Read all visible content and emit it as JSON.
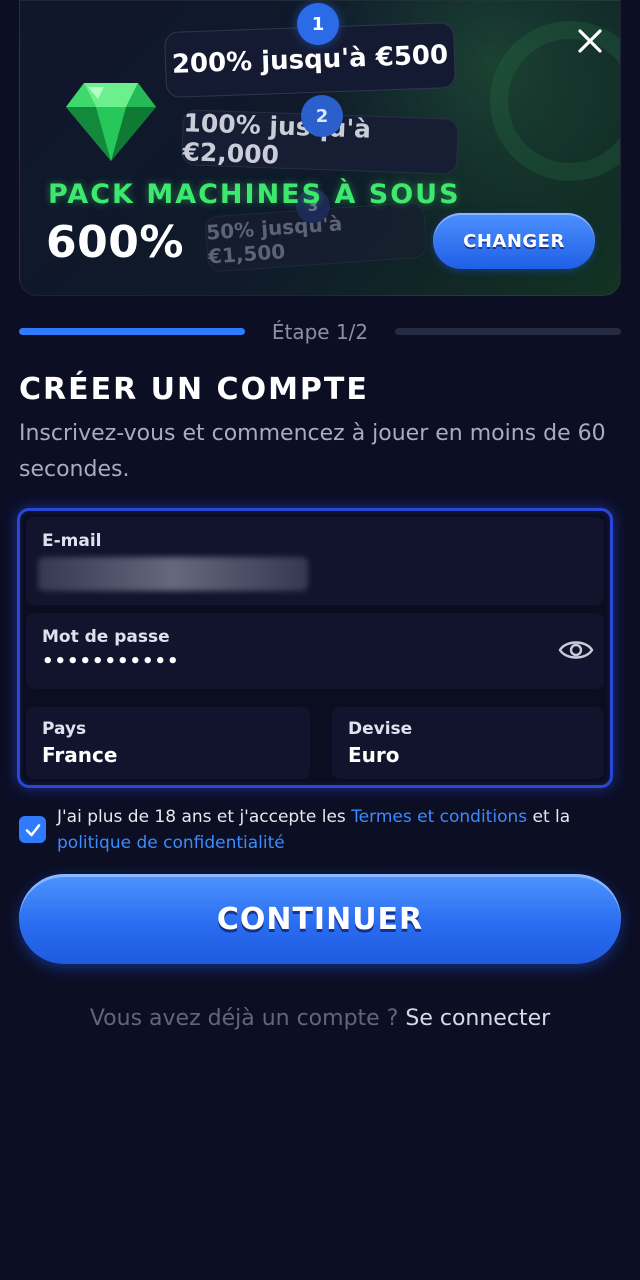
{
  "promo": {
    "tiers": [
      {
        "number": "1",
        "text": "200% jusqu'à €500"
      },
      {
        "number": "2",
        "text": "100% jusqu'à €2,000"
      },
      {
        "number": "3",
        "text": "50% jusqu'à €1,500"
      }
    ],
    "pack_title": "PACK MACHINES À SOUS",
    "pack_value": "600%",
    "change_label": "CHANGER",
    "accent_green": "#3ee86f"
  },
  "progress": {
    "step_label": "Étape 1/2",
    "active_color": "#2f7bff"
  },
  "heading": {
    "title": "CRÉER UN COMPTE",
    "subtitle": "Inscrivez-vous et commencez à jouer en moins de 60 secondes."
  },
  "form": {
    "email_label": "E-mail",
    "password_label": "Mot de passe",
    "password_value": "•••••••••••",
    "country_label": "Pays",
    "country_value": "France",
    "currency_label": "Devise",
    "currency_value": "Euro"
  },
  "terms": {
    "text_before": "J'ai plus de 18 ans et j'accepte les ",
    "terms_link": "Termes et conditions",
    "text_middle": " et la ",
    "privacy_link": "politique de confidentialité",
    "checked": true
  },
  "continue_label": "CONTINUER",
  "login": {
    "prompt": "Vous avez déjà un compte ? ",
    "link": "Se connecter"
  },
  "colors": {
    "background": "#0c0e24",
    "primary": "#2f7bff"
  }
}
